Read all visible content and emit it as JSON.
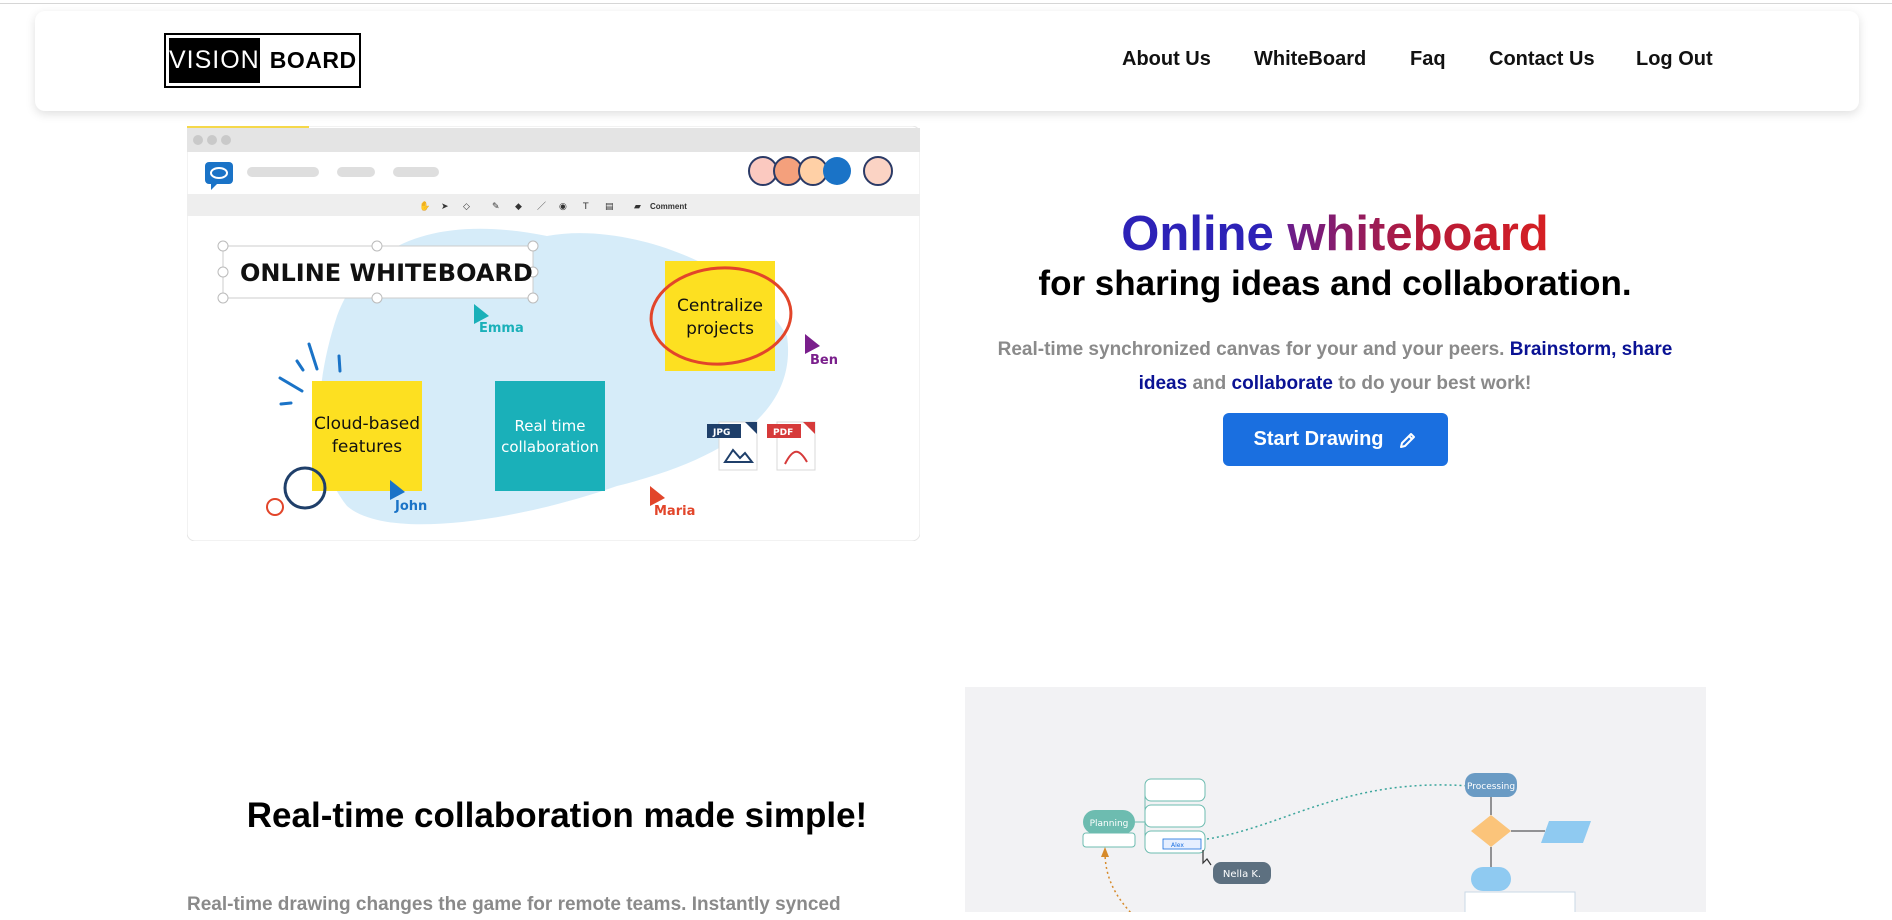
{
  "navbar": {
    "logo_left": "VISION",
    "logo_right": "BOARD",
    "links": [
      "About Us",
      "WhiteBoard",
      "Faq",
      "Contact Us",
      "Log Out"
    ]
  },
  "hero": {
    "illustration": {
      "toolbar_label": "Comment",
      "board_title": "ONLINE WHITEBOARD",
      "notes": {
        "centralize_l1": "Centralize",
        "centralize_l2": "projects",
        "cloud_l1": "Cloud-based",
        "cloud_l2": "features",
        "realtime_l1": "Real time",
        "realtime_l2": "collaboration"
      },
      "cursors": {
        "emma": "Emma",
        "ben": "Ben",
        "john": "John",
        "maria": "Maria"
      },
      "files": {
        "jpg": "JPG",
        "pdf": "PDF"
      }
    },
    "title_word1": "Online",
    "title_word2": "whiteboard",
    "subtitle": "for sharing ideas and collaboration.",
    "desc": {
      "part1": "Real-time synchronized canvas for your and your peers. ",
      "link1": "Brainstorm",
      "part2": ", ",
      "link2": "share ideas",
      "part3": " and ",
      "link3": "collaborate",
      "part4": " to do your best work!"
    },
    "cta_label": "Start Drawing",
    "cta_icon": "pencil-icon"
  },
  "section2": {
    "title": "Real-time collaboration made simple!",
    "text": "Real-time drawing changes the game for remote teams. Instantly synced",
    "diagram": {
      "planning": "Planning",
      "processing": "Processing",
      "user_tag": "Nella K.",
      "chip": "Alex"
    }
  },
  "colors": {
    "accent": "#1a6fe0",
    "title_blue": "#2d22b7",
    "link_navy": "#0a1294",
    "sticky_yellow": "#fde021",
    "teal_note": "#1ab0b9",
    "muted_text": "#8a8a8a"
  }
}
